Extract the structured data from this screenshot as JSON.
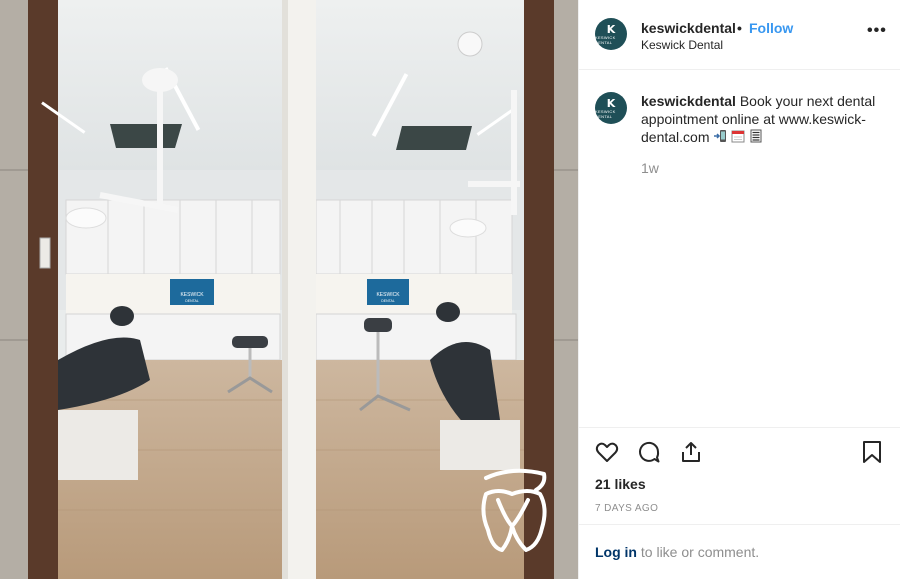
{
  "post": {
    "username": "keswickdental",
    "follow_label": "Follow",
    "bullet": "•",
    "display_name": "Keswick Dental",
    "more_label": "•••",
    "avatar_monogram": "K",
    "avatar_brand": "KESWICK DENTAL"
  },
  "caption": {
    "username": "keswickdental",
    "text": "Book your next dental appointment online at www.keswick-dental.com",
    "emoji": [
      "mobile-phone-arrow",
      "calendar",
      "memo"
    ],
    "time_ago": "1w"
  },
  "actions": {
    "icons": [
      "heart-icon",
      "comment-icon",
      "share-icon",
      "bookmark-icon"
    ],
    "likes": "21 likes",
    "date": "7 DAYS AGO"
  },
  "login": {
    "link": "Log in",
    "rest": " to like or comment."
  },
  "photo": {
    "monitor_brand": "KESWICK",
    "monitor_sub": "DENTAL",
    "logo": "tooth-logo"
  }
}
